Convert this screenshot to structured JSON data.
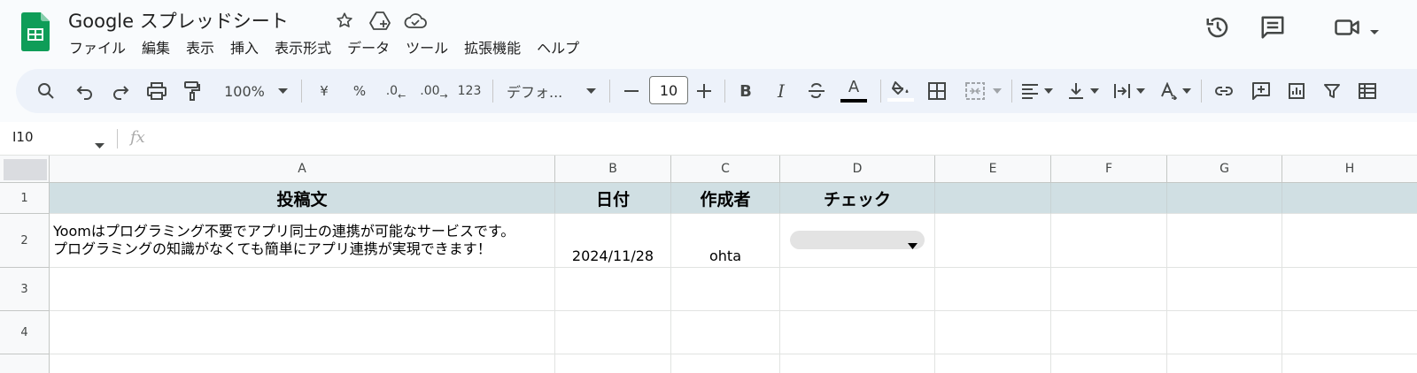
{
  "app": {
    "title": "Google スプレッドシート"
  },
  "menu": [
    "ファイル",
    "編集",
    "表示",
    "挿入",
    "表示形式",
    "データ",
    "ツール",
    "拡張機能",
    "ヘルプ"
  ],
  "toolbar": {
    "zoom": "100%",
    "currency": "¥",
    "percent": "%",
    "decrease_decimal": ".0",
    "increase_decimal": ".00",
    "format_more": "123",
    "font": "デフォ...",
    "font_size": "10",
    "bold": "B",
    "italic": "I",
    "text_color_letter": "A"
  },
  "formula_bar": {
    "name_box": "I10",
    "fx": "fx"
  },
  "sheet": {
    "columns": [
      "A",
      "B",
      "C",
      "D",
      "E",
      "F",
      "G",
      "H"
    ],
    "rows": [
      "1",
      "2",
      "3",
      "4"
    ],
    "header": {
      "a": "投稿文",
      "b": "日付",
      "c": "作成者",
      "d": "チェック"
    },
    "row2": {
      "a_line1": "Yoomはプログラミング不要でアプリ同士の連携が可能なサービスです。",
      "a_line2": "プログラミングの知識がなくても簡単にアプリ連携が実現できます！",
      "b": "2024/11/28",
      "c": "ohta",
      "d": ""
    }
  },
  "colors": {
    "header_fill": "#d0dfe3",
    "toolbar_bg": "#edf2fa",
    "sheets_green": "#0f9d58"
  }
}
